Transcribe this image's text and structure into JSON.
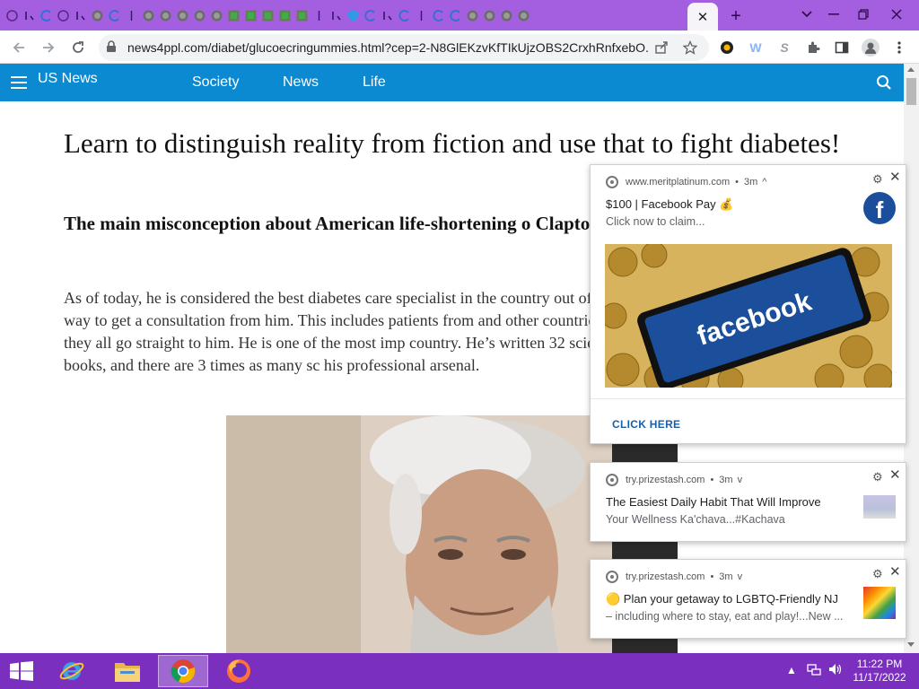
{
  "browser": {
    "url": "news4ppl.com/diabet/glucoecringummies.html?cep=2-N8GlEKzvKfTIkUjzOBS2CrxhRnfxebO...",
    "close_tab_glyph": "✕",
    "new_tab_glyph": "+",
    "tab_icons": [
      "ring-icon",
      "link-icon",
      "blue-c-icon",
      "ring-icon",
      "link-icon",
      "gray-circle-icon",
      "blue-c-icon",
      "tick-icon",
      "gray-circle-icon",
      "gray-circle-icon",
      "gray-circle-icon",
      "gray-circle-icon",
      "gray-circle-icon",
      "green-puzzle-icon",
      "green-puzzle-icon",
      "green-puzzle-icon",
      "green-puzzle-icon",
      "green-puzzle-icon",
      "tick-icon",
      "link-icon",
      "shield-icon",
      "blue-c-icon",
      "link-icon",
      "blue-c-icon",
      "tick-icon",
      "blue-c-icon",
      "blue-c-icon",
      "gray-circle-icon",
      "gray-circle-icon",
      "gray-circle-icon",
      "gray-circle-icon"
    ]
  },
  "site": {
    "brand": "US News",
    "nav": [
      "Society",
      "News",
      "Life"
    ]
  },
  "article": {
    "headline": "Learn to distinguish reality from fiction and use that to fight diabetes!",
    "subhead": "The main misconception about American life-shortening o Clapton is an American endocrinologist.",
    "body": "As of today, he is considered the best diabetes care specialist in the country out of their way to get a consultation from him. This includes patients from and other countries - they all go straight to him. He is one of the most imp country. He’s written 32 scientific books, and there are 3 times as many sc his professional arsenal."
  },
  "notifications": [
    {
      "source": "www.meritplatinum.com",
      "age": "3m",
      "caret": "^",
      "title": "$100 | Facebook Pay 💰",
      "body": "Click now to claim...",
      "image_word": "facebook",
      "cta": "CLICK HERE"
    },
    {
      "source": "try.prizestash.com",
      "age": "3m",
      "caret": "v",
      "title": "The Easiest Daily Habit That Will Improve",
      "body": "Your Wellness Ka'chava...#Kachava"
    },
    {
      "source": "try.prizestash.com",
      "age": "3m",
      "caret": "v",
      "title": "🟡 Plan your getaway to LGBTQ-Friendly NJ",
      "body": "– including where to stay, eat and play!...New ..."
    }
  ],
  "taskbar": {
    "time": "11:22 PM",
    "date": "11/17/2022"
  },
  "colors": {
    "tabstrip": "#a35fe0",
    "sitenav": "#0b8ad2",
    "taskbar": "#7a2fbf",
    "facebook_blue": "#1b4f9c"
  }
}
